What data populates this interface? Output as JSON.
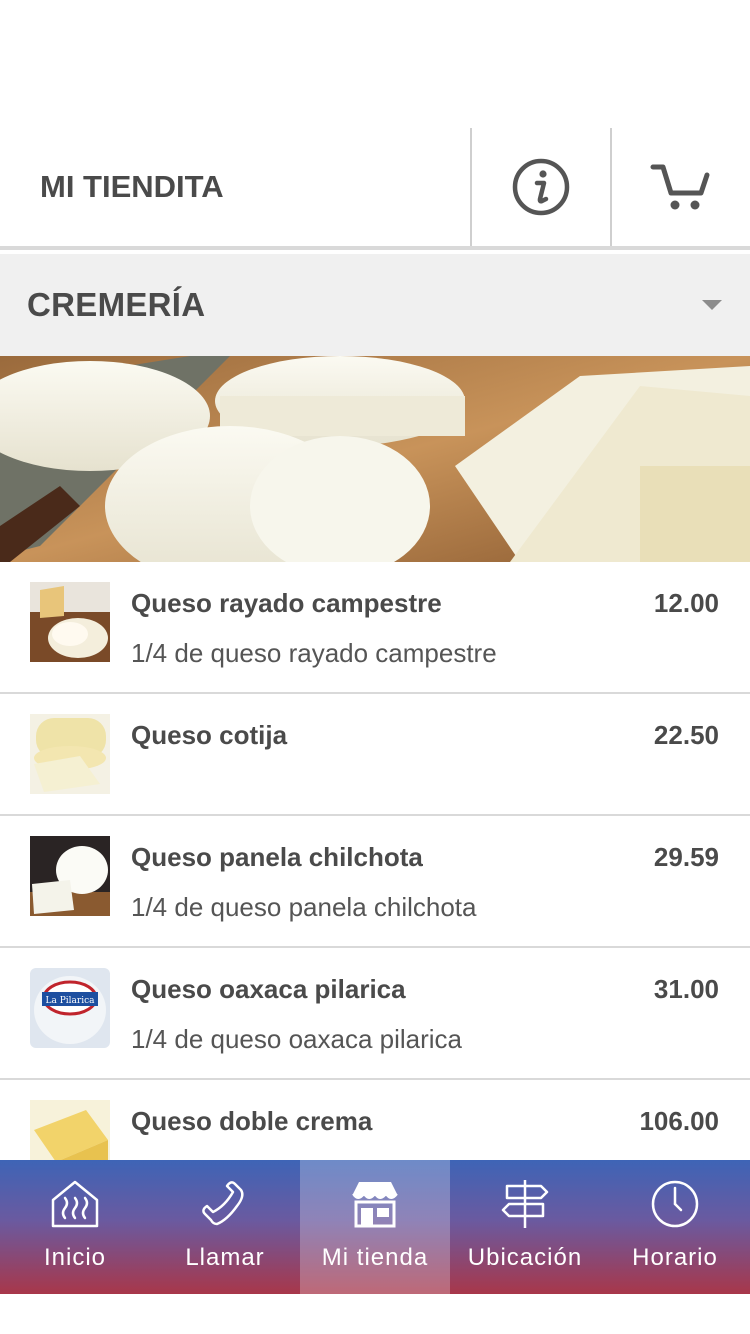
{
  "header": {
    "title": "MI TIENDITA",
    "info_icon": "info-icon",
    "cart_icon": "cart-icon"
  },
  "category": {
    "selected": "CREMERÍA"
  },
  "banner": {
    "image": "cheese-banner"
  },
  "products": [
    {
      "name": "Queso rayado campestre",
      "price": "12.00",
      "description": "1/4 de queso rayado campestre",
      "thumb": "grated-cheese"
    },
    {
      "name": "Queso cotija",
      "price": "22.50",
      "description": "",
      "thumb": "cotija-cheese"
    },
    {
      "name": "Queso panela chilchota",
      "price": "29.59",
      "description": "1/4 de queso panela chilchota",
      "thumb": "panela-cheese"
    },
    {
      "name": "Queso oaxaca pilarica",
      "price": "31.00",
      "description": "1/4 de queso oaxaca pilarica",
      "thumb": "oaxaca-package",
      "thumb_text": "La Pilarica"
    },
    {
      "name": "Queso doble crema",
      "price": "106.00",
      "description": "",
      "thumb": "doble-crema-cheese"
    }
  ],
  "tabs": [
    {
      "label": "Inicio",
      "icon": "home-icon",
      "active": false
    },
    {
      "label": "Llamar",
      "icon": "phone-icon",
      "active": false
    },
    {
      "label": "Mi tienda",
      "icon": "store-icon",
      "active": true
    },
    {
      "label": "Ubicación",
      "icon": "signpost-icon",
      "active": false
    },
    {
      "label": "Horario",
      "icon": "clock-icon",
      "active": false
    }
  ],
  "colors": {
    "tab_gradient_top": "#3e64b6",
    "tab_gradient_bottom": "#a8374a",
    "text_dark": "#4a4a4a",
    "category_bg": "#f0f0f0"
  }
}
